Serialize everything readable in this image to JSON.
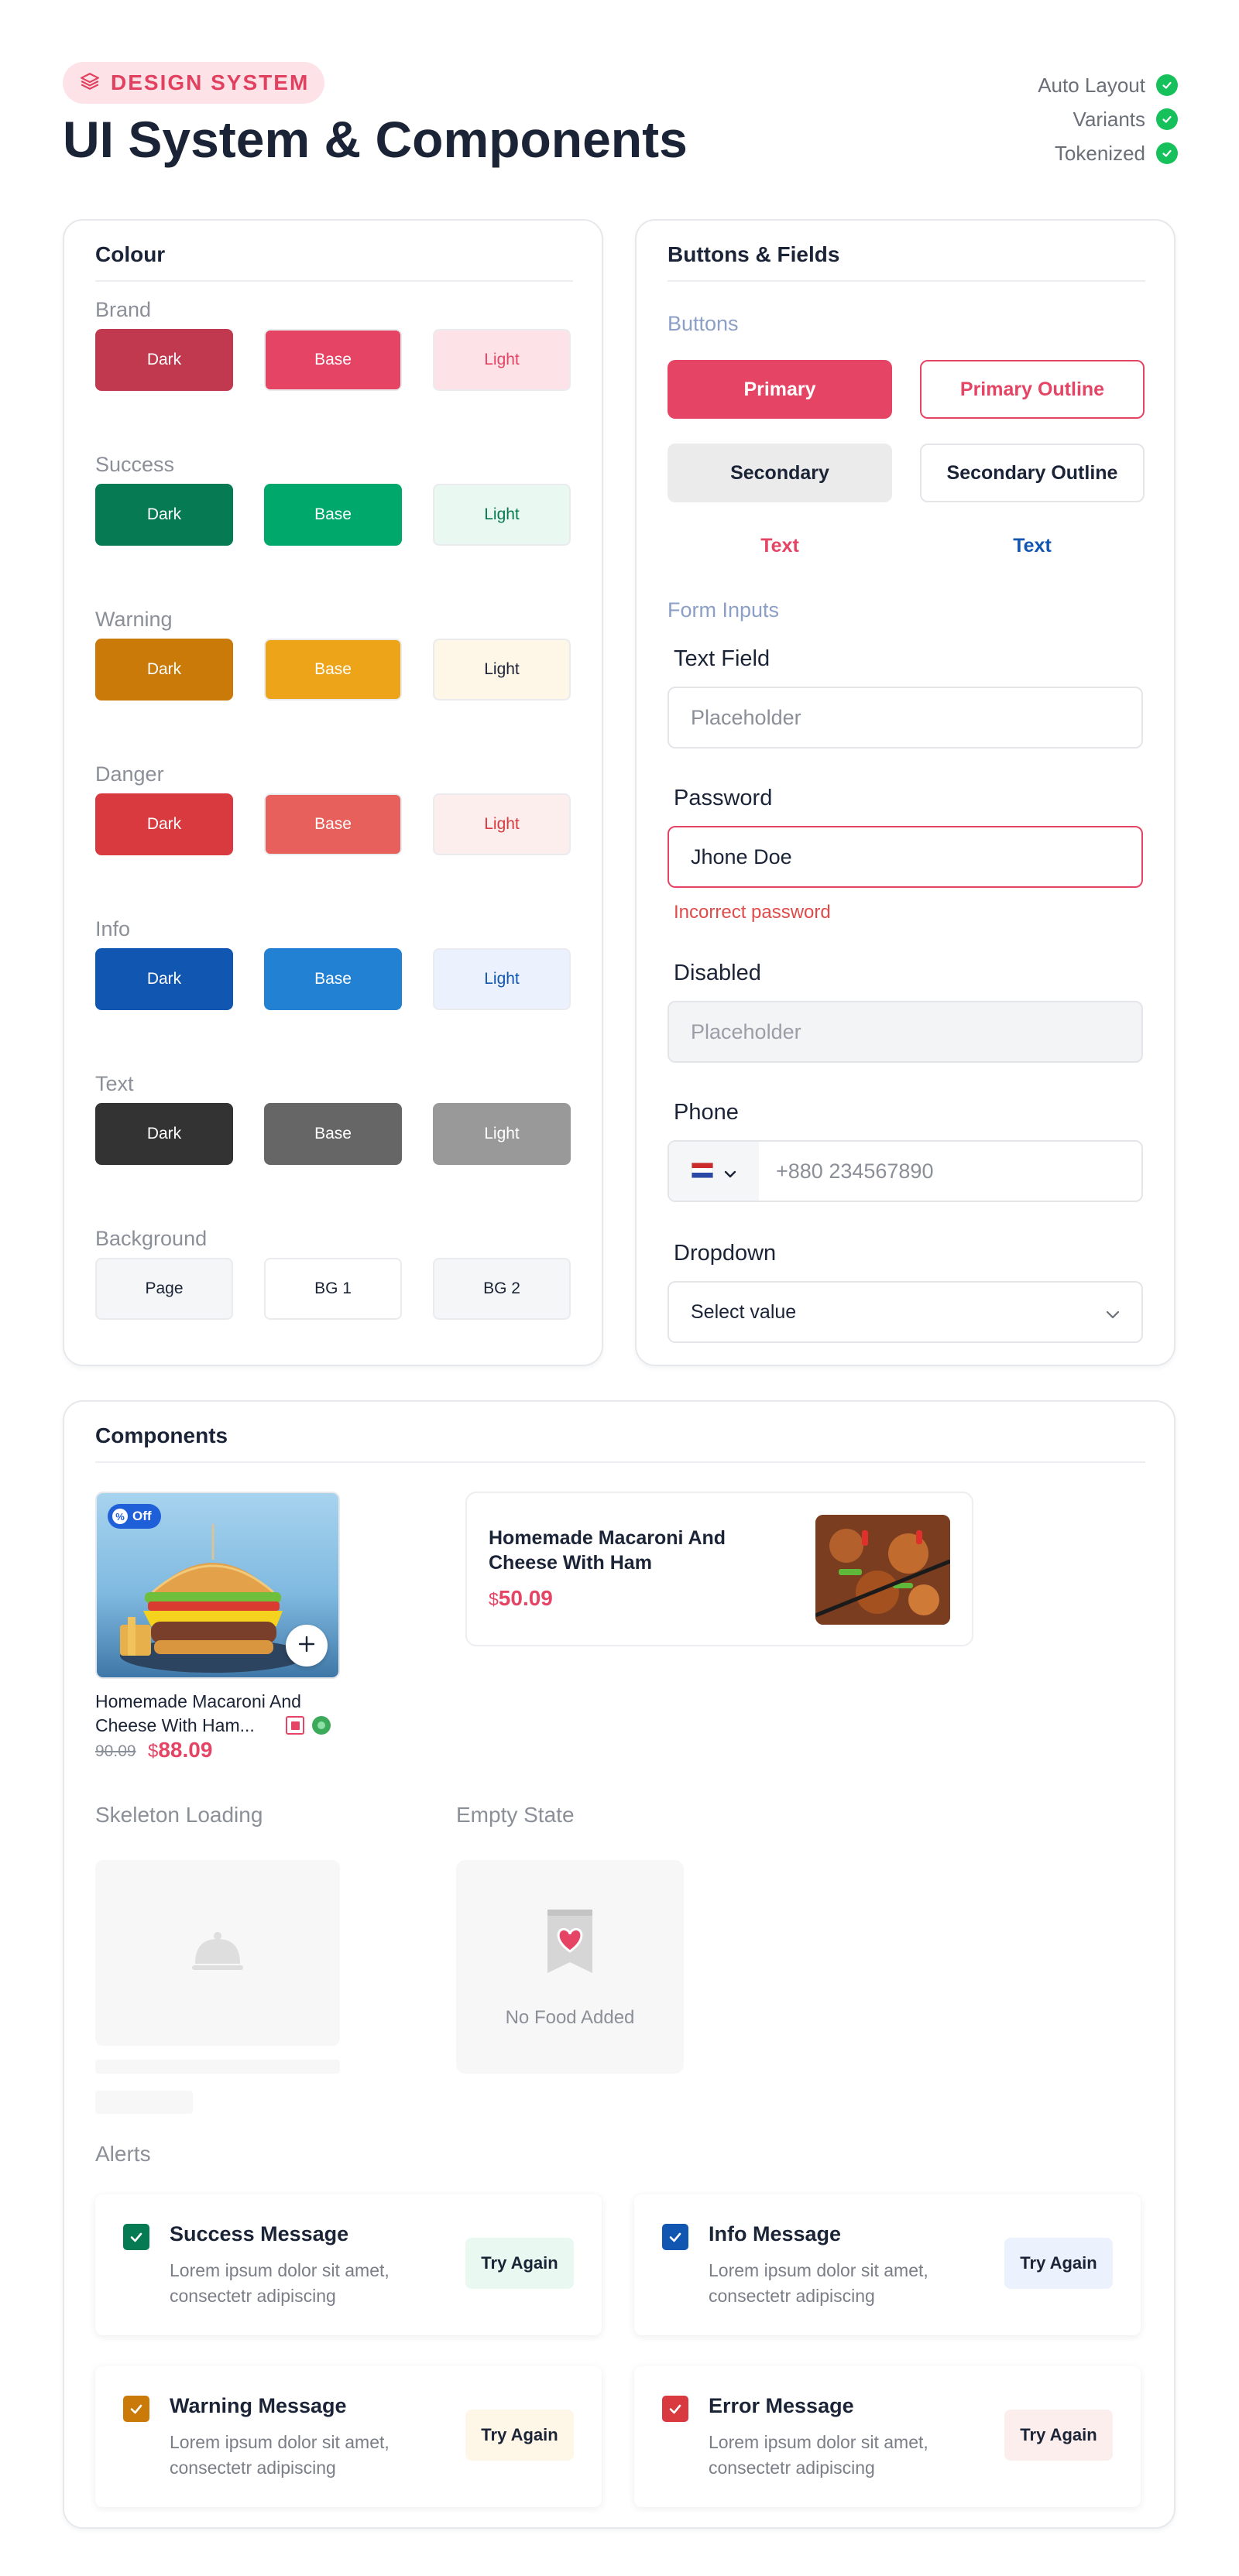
{
  "header": {
    "badge": "DESIGN SYSTEM",
    "title": "UI System & Components",
    "features": [
      "Auto Layout",
      "Variants",
      "Tokenized"
    ]
  },
  "colour": {
    "title": "Colour",
    "groups": [
      {
        "name": "Brand",
        "swatches": [
          {
            "label": "Dark",
            "bg": "#c0394f",
            "fg": "#ffffff"
          },
          {
            "label": "Base",
            "bg": "#e54464",
            "fg": "#ffffff"
          },
          {
            "label": "Light",
            "bg": "#fde3e8",
            "fg": "#e54464"
          }
        ]
      },
      {
        "name": "Success",
        "swatches": [
          {
            "label": "Dark",
            "bg": "#067a52",
            "fg": "#ffffff"
          },
          {
            "label": "Base",
            "bg": "#00a86b",
            "fg": "#ffffff"
          },
          {
            "label": "Light",
            "bg": "#eaf8f2",
            "fg": "#067a52"
          }
        ]
      },
      {
        "name": "Warning",
        "swatches": [
          {
            "label": "Dark",
            "bg": "#c97a08",
            "fg": "#ffffff"
          },
          {
            "label": "Base",
            "bg": "#eea419",
            "fg": "#ffffff"
          },
          {
            "label": "Light",
            "bg": "#fef6e6",
            "fg": "#1b2437"
          }
        ]
      },
      {
        "name": "Danger",
        "swatches": [
          {
            "label": "Dark",
            "bg": "#d83a3f",
            "fg": "#ffffff"
          },
          {
            "label": "Base",
            "bg": "#e8605b",
            "fg": "#ffffff"
          },
          {
            "label": "Light",
            "bg": "#fdeeee",
            "fg": "#d83a3f"
          }
        ]
      },
      {
        "name": "Info",
        "swatches": [
          {
            "label": "Dark",
            "bg": "#1156b0",
            "fg": "#ffffff"
          },
          {
            "label": "Base",
            "bg": "#2381d4",
            "fg": "#ffffff"
          },
          {
            "label": "Light",
            "bg": "#ebf2fd",
            "fg": "#1156b0"
          }
        ]
      },
      {
        "name": "Text",
        "swatches": [
          {
            "label": "Dark",
            "bg": "#333333",
            "fg": "#ffffff"
          },
          {
            "label": "Base",
            "bg": "#666666",
            "fg": "#ffffff"
          },
          {
            "label": "Light",
            "bg": "#999999",
            "fg": "#ffffff"
          }
        ]
      },
      {
        "name": "Background",
        "swatches": [
          {
            "label": "Page",
            "bg": "#f5f6f7",
            "fg": "#1b2437"
          },
          {
            "label": "BG 1",
            "bg": "#ffffff",
            "fg": "#1b2437"
          },
          {
            "label": "BG 2",
            "bg": "#f5f6f7",
            "fg": "#1b2437"
          }
        ]
      }
    ]
  },
  "buttons_fields": {
    "title": "Buttons & Fields",
    "buttons_label": "Buttons",
    "primary": "Primary",
    "primary_outline": "Primary Outline",
    "secondary": "Secondary",
    "secondary_outline": "Secondary Outline",
    "text_brand": "Text",
    "text_info": "Text",
    "form_label": "Form Inputs",
    "text_field_label": "Text Field",
    "text_field_placeholder": "Placeholder",
    "password_label": "Password",
    "password_value": "Jhone Doe",
    "password_error": "Incorrect password",
    "disabled_label": "Disabled",
    "disabled_placeholder": "Placeholder",
    "phone_label": "Phone",
    "phone_placeholder": "+880 234567890",
    "dropdown_label": "Dropdown",
    "dropdown_value": "Select value"
  },
  "components": {
    "title": "Components",
    "food_card": {
      "badge": "Off",
      "name": "Homemade Macaroni And Cheese With Ham...",
      "old_price": "90.09",
      "currency": "$",
      "price": "88.09"
    },
    "food_card_h": {
      "name": "Homemade Macaroni And Cheese With Ham",
      "currency": "$",
      "price": "50.09"
    },
    "skeleton_label": "Skeleton Loading",
    "empty_label": "Empty State",
    "empty_text": "No Food Added",
    "alerts_label": "Alerts",
    "alerts": [
      {
        "title": "Success Message",
        "message": "Lorem ipsum dolor sit amet, consectetr adipiscing",
        "action": "Try Again",
        "color": "#067a52",
        "action_bg": "#eaf8f2"
      },
      {
        "title": "Info Message",
        "message": "Lorem ipsum dolor sit amet, consectetr adipiscing",
        "action": "Try Again",
        "color": "#1156b0",
        "action_bg": "#ebf2fd"
      },
      {
        "title": "Warning Message",
        "message": "Lorem ipsum dolor sit amet, consectetr adipiscing",
        "action": "Try Again",
        "color": "#c97a08",
        "action_bg": "#fef6e6"
      },
      {
        "title": "Error Message",
        "message": "Lorem ipsum dolor sit amet, consectetr adipiscing",
        "action": "Try Again",
        "color": "#d83a3f",
        "action_bg": "#fdeeee"
      }
    ]
  }
}
